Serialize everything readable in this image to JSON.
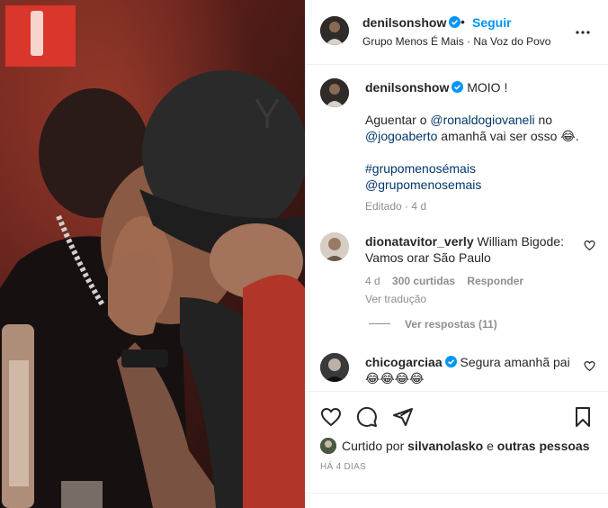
{
  "post": {
    "username": "denilsonshow",
    "follow_label": "Seguir",
    "dot": "•",
    "location": "Grupo Menos É Mais · Na Voz do Povo",
    "more_icon": "more-horizontal-icon"
  },
  "caption": {
    "username": "denilsonshow",
    "headline": "MOIO !",
    "line1_pre": "Aguentar o ",
    "line1_mention": "@ronaldogiovaneli",
    "line1_post": " no",
    "line2_mention": "@jogoaberto",
    "line2_post": " amanhã vai ser osso 😂.",
    "hashtag": "#grupomenosémais",
    "mention3": "@grupomenosemais",
    "meta": "Editado · 4 d"
  },
  "comments": [
    {
      "username": "dionatavitor_verly",
      "text": "William Bigode: Vamos orar São Paulo",
      "age": "4 d",
      "likes": "300 curtidas",
      "reply": "Responder",
      "translate": "Ver tradução",
      "view_replies": "Ver respostas (11)"
    },
    {
      "username": "chicogarciaa",
      "text": "Segura amanhã pai",
      "emojis": "😂😂😂😂"
    }
  ],
  "actions": {
    "liked_prefix": "Curtido por ",
    "liked_user": "silvanolasko",
    "liked_suffix": " e ",
    "liked_others": "outras pessoas",
    "time_ago": "HÁ 4 DIAS"
  },
  "colors": {
    "accent": "#0095f6",
    "link": "#00376b",
    "muted": "#8e8e8e",
    "text": "#262626",
    "verified": "#0095f6"
  }
}
